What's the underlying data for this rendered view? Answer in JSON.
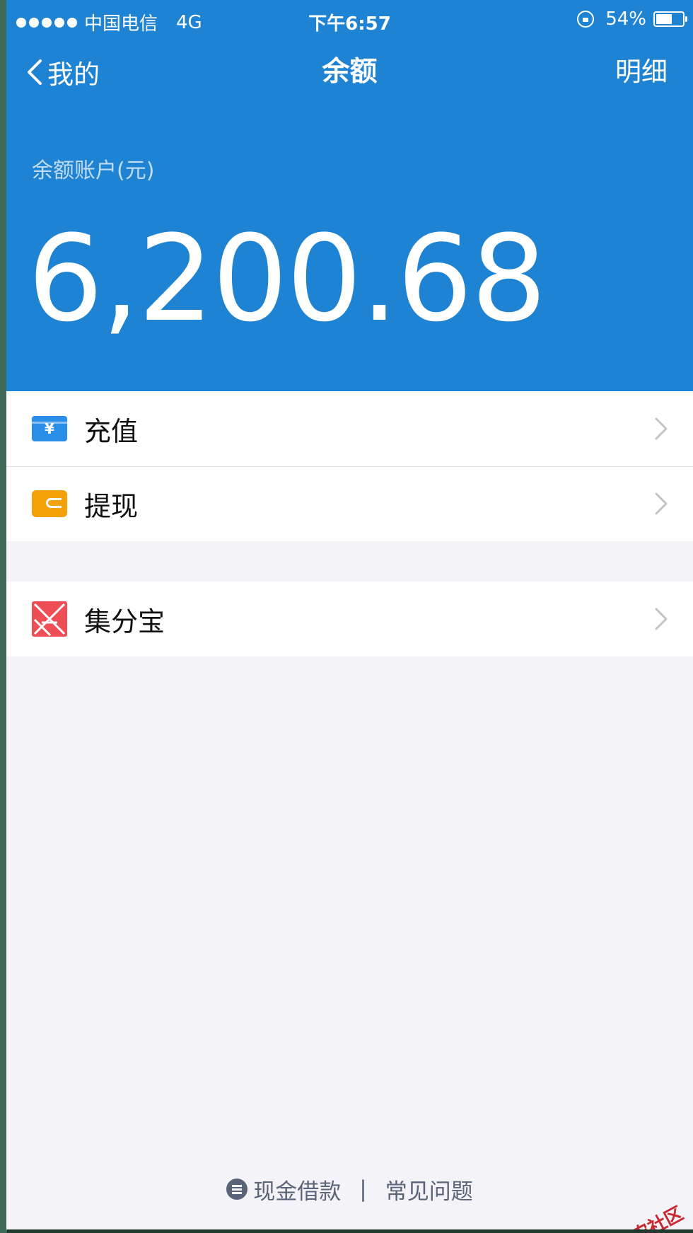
{
  "status_bar": {
    "carrier": "中国电信",
    "network": "4G",
    "time": "下午6:57",
    "battery": "54%"
  },
  "nav": {
    "back_label": "我的",
    "title": "余额",
    "detail_label": "明细"
  },
  "balance": {
    "label": "余额账户(元)",
    "amount": "6,200.68"
  },
  "actions": [
    {
      "label": "充值",
      "icon": "recharge-icon",
      "symbol": "¥"
    },
    {
      "label": "提现",
      "icon": "withdraw-icon"
    }
  ],
  "services": [
    {
      "label": "集分宝",
      "icon": "jifenbao-icon"
    }
  ],
  "footer": {
    "cash_loan": "现金借款",
    "separator": "|",
    "faq": "常见问题"
  },
  "watermark": "卡农社区",
  "colors": {
    "header_bg": "#1f83d4",
    "recharge_icon": "#2a8ee8",
    "withdraw_icon": "#f3a106",
    "jifenbao_icon": "#ee4e55"
  }
}
